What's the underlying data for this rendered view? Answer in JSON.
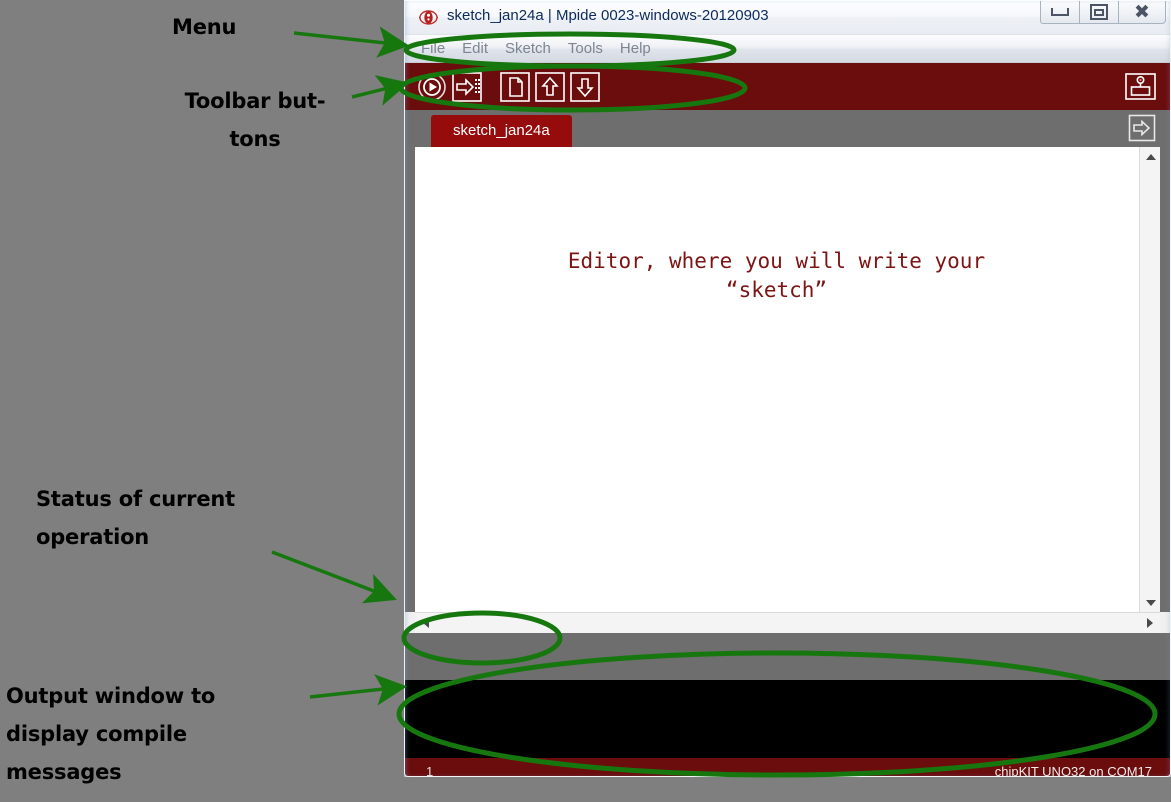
{
  "annotations": [
    {
      "id": "menu",
      "text": "Menu"
    },
    {
      "id": "toolbar",
      "text": "Toolbar but-\ntons"
    },
    {
      "id": "status",
      "text": "Status of current\noperation"
    },
    {
      "id": "output",
      "text": "Output window to\ndisplay compile\nmessages"
    }
  ],
  "window": {
    "title": "sketch_jan24a | Mpide 0023-windows-20120903",
    "icon": "mpide-logo-icon",
    "controls": {
      "minimize": "minimize-icon",
      "maximize": "maximize-icon",
      "close": "close-icon"
    }
  },
  "menu": {
    "items": [
      {
        "label": "File"
      },
      {
        "label": "Edit"
      },
      {
        "label": "Sketch"
      },
      {
        "label": "Tools"
      },
      {
        "label": "Help"
      }
    ]
  },
  "toolbar": {
    "background": "#6b0d0d",
    "buttons": [
      {
        "name": "verify-compile-button",
        "icon": "play-circle-icon"
      },
      {
        "name": "upload-button",
        "icon": "arrow-right-dots-icon"
      },
      {
        "name": "new-sketch-button",
        "icon": "new-file-icon"
      },
      {
        "name": "open-sketch-button",
        "icon": "arrow-up-icon"
      },
      {
        "name": "save-sketch-button",
        "icon": "arrow-down-icon"
      }
    ],
    "serial_monitor": {
      "name": "serial-monitor-button",
      "icon": "serial-monitor-icon"
    }
  },
  "tabs": {
    "active": "sketch_jan24a",
    "overflow_button": "tab-overflow-icon"
  },
  "editor": {
    "text": "Editor, where you will write your\n“sketch”",
    "text_color": "#7d1414",
    "background": "#ffffff"
  },
  "scrollbars": {
    "vertical": {
      "up": "scroll-up-arrow",
      "down": "scroll-down-arrow"
    },
    "horizontal": {
      "left": "scroll-left-arrow",
      "right": "scroll-right-arrow"
    }
  },
  "console": {
    "text": "",
    "background": "#000000"
  },
  "status_bar": {
    "line_number": "1",
    "board": "chipKIT UNO32 on COM17",
    "background": "#6b0d0d"
  },
  "colors": {
    "desktop": "#7f7f7f",
    "accent_red": "#6b0d0d",
    "tab_red": "#960b0b",
    "panel_gray": "#6e6e6e",
    "annotation_green": "#17770f"
  }
}
